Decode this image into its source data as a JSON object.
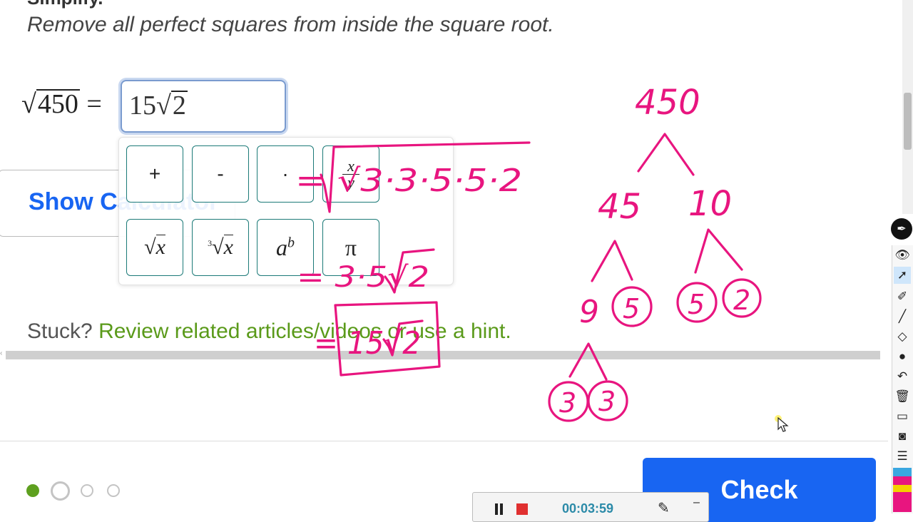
{
  "problem": {
    "heading_partial": "Simplify.",
    "instruction": "Remove all perfect squares from inside the square root.",
    "lhs_radicand": "450",
    "equals": "=",
    "answer": {
      "coefficient": "15",
      "radicand": "2"
    }
  },
  "show_calculator": {
    "label": "Show Calculator"
  },
  "keypad": {
    "keys": [
      {
        "label": "+"
      },
      {
        "label": "-"
      },
      {
        "label": "·"
      },
      {
        "label": "x/y"
      },
      {
        "label": "√x"
      },
      {
        "label": "∛x"
      },
      {
        "label": "a^b"
      },
      {
        "label": "π"
      }
    ]
  },
  "stuck": {
    "prefix": "Stuck?",
    "link": "Review related articles/videos or use a hint."
  },
  "progress": {
    "total": 4,
    "current_index": 1,
    "completed": 1
  },
  "check_button": {
    "label": "Check"
  },
  "recorder": {
    "time": "00:03:59"
  },
  "annotations": {
    "color": "#e8157f",
    "factor_tree": [
      "450",
      "45",
      "10",
      "9",
      "5",
      "5",
      "2",
      "3",
      "3"
    ],
    "work_lines": [
      "= √3·3·5·5·2",
      "= 3·5√2",
      "= 15√2"
    ]
  },
  "colors": {
    "accent_blue": "#1865f2",
    "link_green": "#5a9a1a",
    "keypad_border": "#1c7a78",
    "ink_pink": "#e8157f",
    "progress_green": "#5ea01f"
  },
  "toolbar": {
    "icons": [
      "pen-tool-icon",
      "eye-icon",
      "cursor-icon",
      "highlighter-icon",
      "line-icon",
      "eraser-icon",
      "dot-icon",
      "undo-icon",
      "trash-icon",
      "whiteboard-icon",
      "camera-icon",
      "clipboard-icon",
      "color-palette-icon"
    ]
  }
}
